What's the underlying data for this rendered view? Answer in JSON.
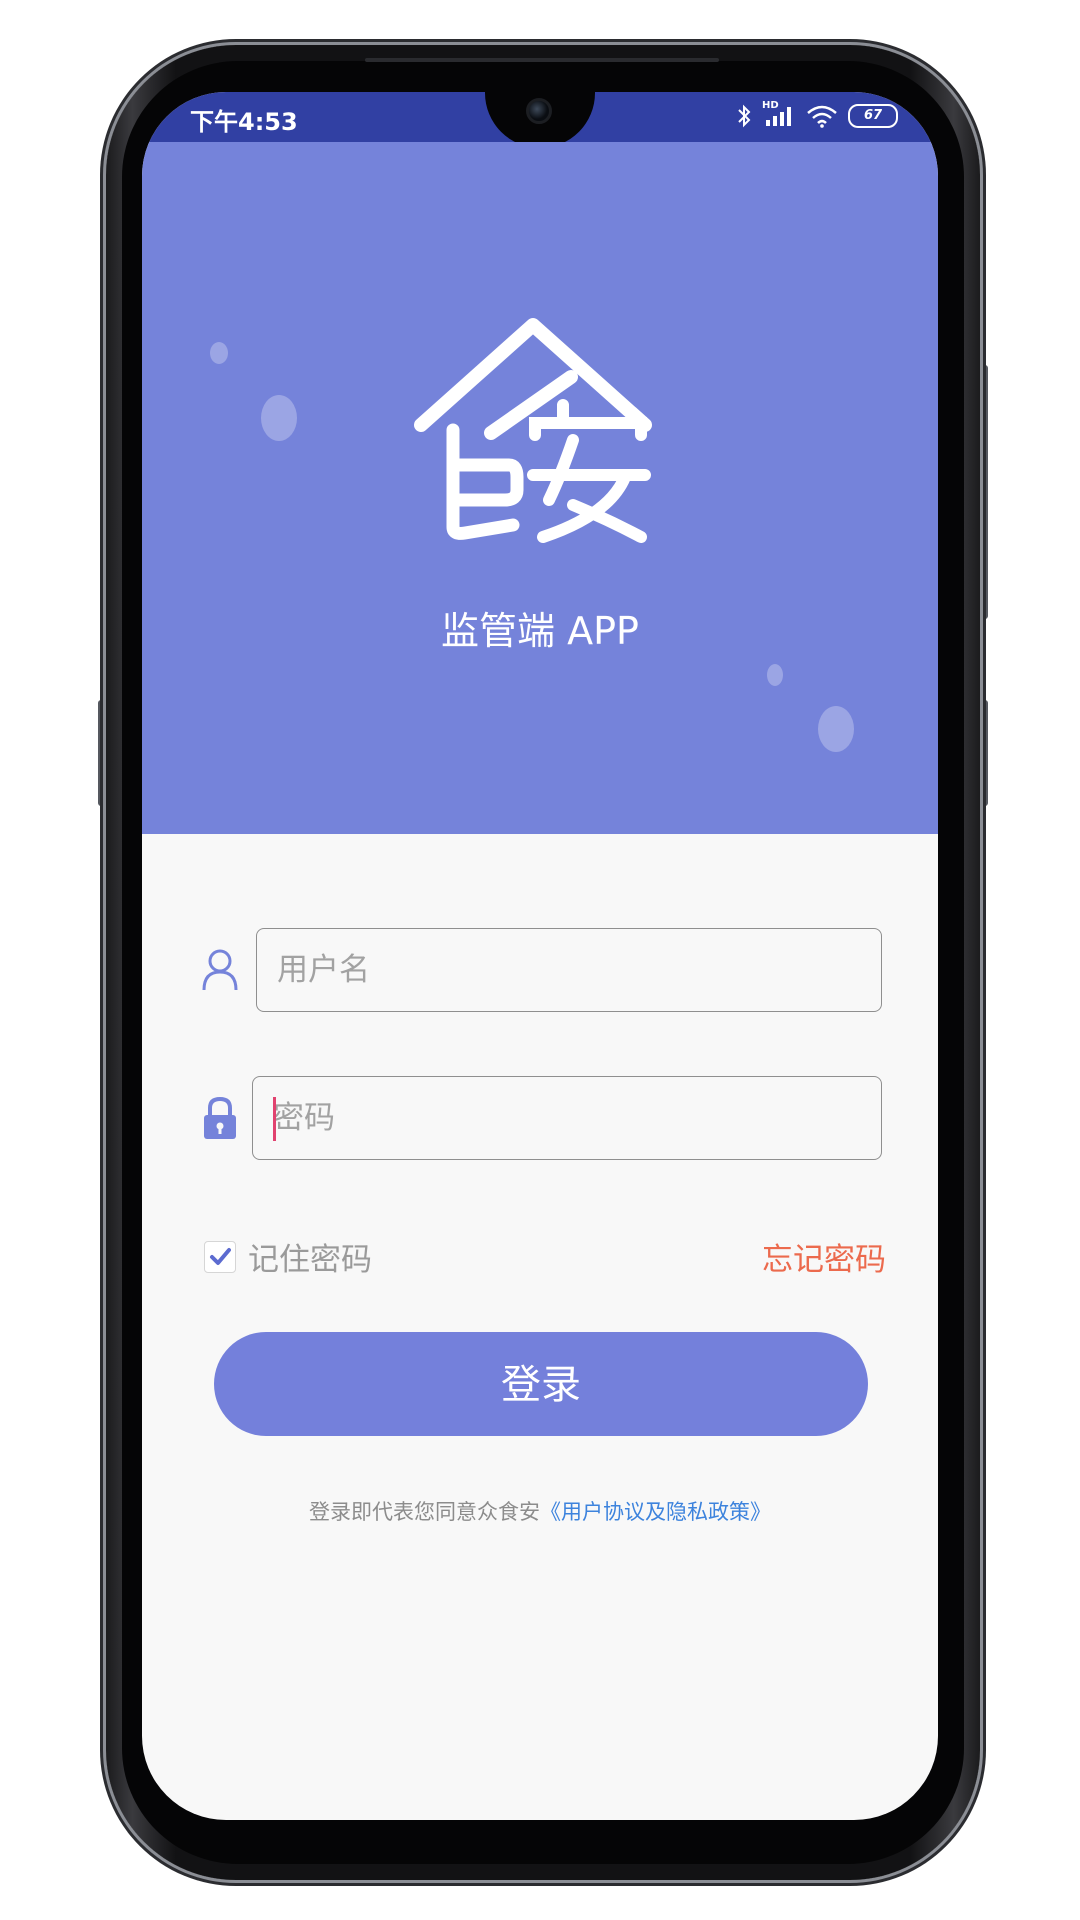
{
  "status_bar": {
    "time": "下午4:53",
    "network": "HD",
    "battery": "67"
  },
  "app": {
    "subtitle": "监管端 APP",
    "logo": "食安"
  },
  "form": {
    "username_placeholder": "用户名",
    "password_placeholder": "密码",
    "remember_label": "记住密码",
    "remember_checked": true,
    "forgot_label": "忘记密码",
    "login_label": "登录"
  },
  "agreement": {
    "prefix": "登录即代表您同意众食安",
    "link": "《用户协议及隐私政策》"
  },
  "colors": {
    "accent": "#7583da",
    "status_bar": "#3140a3",
    "forgot": "#ec6a4d",
    "link": "#3d83dd",
    "caret": "#e1426f"
  }
}
